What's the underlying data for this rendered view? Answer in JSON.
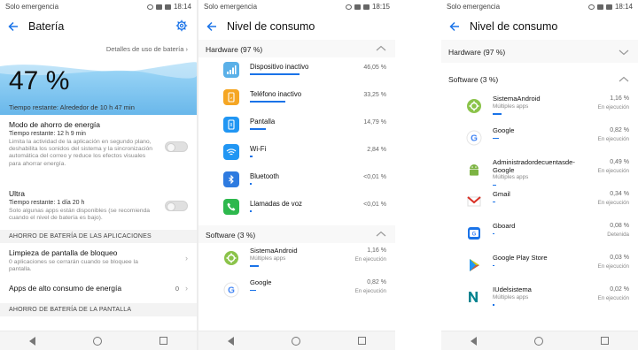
{
  "colors": {
    "accent": "#1a73e8",
    "wave": "#5ab0e8"
  },
  "panel1": {
    "status": {
      "left": "Solo emergencia",
      "time": "18:14"
    },
    "title": "Batería",
    "details_link": "Detalles de uso de batería",
    "battery_percent": "47 %",
    "remaining": "Tiempo restante: Alrededor de 10 h 47 min",
    "power_saving": {
      "title": "Modo de ahorro de energía",
      "time": "Tiempo restante: 12 h 9 min",
      "desc": "Limita la actividad de la aplicación en segundo plano, deshabilita los sonidos del sistema y la sincronización automática del correo y reduce los efectos visuales para ahorrar energía."
    },
    "ultra": {
      "title": "Ultra",
      "time": "Tiempo restante: 1 día 20 h",
      "desc": "Solo algunas apps están disponibles (se recomienda cuando el nivel de batería es bajo)."
    },
    "section_apps": "AHORRO DE BATERÍA DE LAS APLICACIONES",
    "lock_cleanup": {
      "title": "Limpieza de pantalla de bloqueo",
      "desc": "0 aplicaciones se cerrarán cuando se bloquee la pantalla."
    },
    "high_consumption": {
      "title": "Apps de alto consumo de energía",
      "count": "0"
    },
    "section_screen": "AHORRO DE BATERÍA DE LA PANTALLA"
  },
  "panel2": {
    "status": {
      "left": "Solo emergencia",
      "time": "18:15"
    },
    "title": "Nivel de consumo",
    "hardware_header": "Hardware (97 %)",
    "hardware": [
      {
        "name": "Dispositivo inactivo",
        "pct": "46,05 %",
        "fraction": 0.4605,
        "color": "#5ab0e8",
        "icon": "signal-icon"
      },
      {
        "name": "Teléfono inactivo",
        "pct": "33,25 %",
        "fraction": 0.3325,
        "color": "#f5a623",
        "icon": "phone-idle-icon"
      },
      {
        "name": "Pantalla",
        "pct": "14,79 %",
        "fraction": 0.1479,
        "color": "#2196f3",
        "icon": "screen-icon"
      },
      {
        "name": "Wi-Fi",
        "pct": "2,84 %",
        "fraction": 0.0284,
        "color": "#2196f3",
        "icon": "wifi-icon"
      },
      {
        "name": "Bluetooth",
        "pct": "<0,01 %",
        "fraction": 0.0001,
        "color": "#2e7be0",
        "icon": "bluetooth-icon"
      },
      {
        "name": "Llamadas de voz",
        "pct": "<0,01 %",
        "fraction": 0.0001,
        "color": "#2db84d",
        "icon": "call-icon"
      }
    ],
    "software_header": "Software (3 %)",
    "software": [
      {
        "name": "SistemaAndroid",
        "sub": "Múltiples apps",
        "pct": "1,16 %",
        "state": "En ejecución",
        "fraction": 0.0116,
        "icon": "android-system-icon"
      },
      {
        "name": "Google",
        "sub": "",
        "pct": "0,82 %",
        "state": "En ejecución",
        "fraction": 0.0082,
        "icon": "google-icon"
      }
    ]
  },
  "panel3": {
    "status": {
      "left": "Solo emergencia",
      "time": "18:14"
    },
    "title": "Nivel de consumo",
    "hardware_header": "Hardware (97 %)",
    "software_header": "Software (3 %)",
    "software": [
      {
        "name": "SistemaAndroid",
        "sub": "Múltiples apps",
        "pct": "1,16 %",
        "state": "En ejecución",
        "fraction": 0.0116,
        "icon": "android-system-icon"
      },
      {
        "name": "Google",
        "sub": "",
        "pct": "0,82 %",
        "state": "En ejecución",
        "fraction": 0.0082,
        "icon": "google-icon"
      },
      {
        "name": "Administradordecuentasde-Google",
        "sub": "Múltiples apps",
        "pct": "0,49 %",
        "state": "En ejecución",
        "fraction": 0.0049,
        "icon": "android-icon"
      },
      {
        "name": "Gmail",
        "sub": "",
        "pct": "0,34 %",
        "state": "En ejecución",
        "fraction": 0.0034,
        "icon": "gmail-icon"
      },
      {
        "name": "Gboard",
        "sub": "",
        "pct": "0,08 %",
        "state": "Detenida",
        "fraction": 0.0008,
        "icon": "gboard-icon"
      },
      {
        "name": "Google Play Store",
        "sub": "",
        "pct": "0,03 %",
        "state": "En ejecución",
        "fraction": 0.0003,
        "icon": "play-store-icon"
      },
      {
        "name": "IUdelsistema",
        "sub": "Múltiples apps",
        "pct": "0,02 %",
        "state": "En ejecución",
        "fraction": 0.0002,
        "icon": "system-ui-icon"
      }
    ]
  }
}
